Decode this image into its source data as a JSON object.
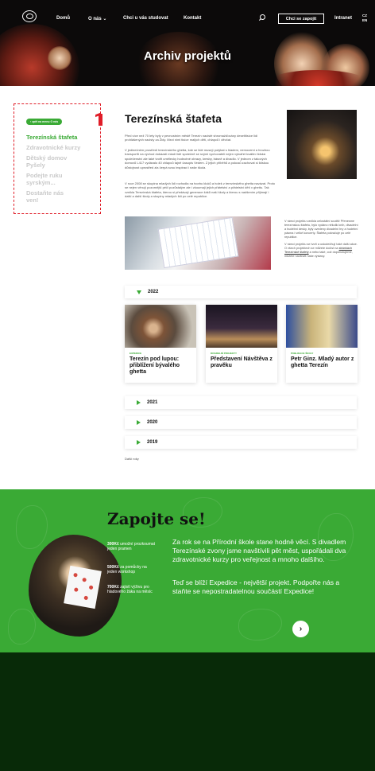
{
  "header": {
    "nav": [
      "Domů",
      "O nás",
      "Chci u vás studovat",
      "Kontakt"
    ],
    "nav_caret": "⌄",
    "join_label": "Chci se zapojit",
    "intranet_label": "Intranet",
    "lang": [
      "CZ",
      "EN"
    ],
    "hero_title": "Archiv projektů"
  },
  "sidebar": {
    "back_label": "‹  zpět na menu O nás",
    "items": [
      "Terezínská štafeta",
      "Zdravotnické kurzy",
      "Dětský domov Pyšely",
      "Podejte ruku syrským...",
      "Dostaňte nás ven!"
    ]
  },
  "article": {
    "title": "Terezínská štafeta",
    "p1": "Před více než 70 lety byly v pevnostním městě Terezín nacisté shromažďovány desetitisíce lidí prohlášených nacisty za Židy. Mezi nimi tisíce malých dětí, chlapců i děvčat.",
    "p2": "V jedinečném prostředí terezínského ghetta, kde se lidé musejí potýkat s hladem, nemocemi a hrozbou transportů na východ dokázali mladí lidé společně se svými vychovateli nejen vytvářet kvalitní lidská společenství ale také tvořit umělecky hodnotné obrazy, kresby, básně a divadlo. V jednom z takových domovů L417 vydávalo 40 chlapců tajně časopis Vedem. Z jejich příběhů a pokusů zachovat si lidskou důstojnost uprostřed zla čerpá svou inspiraci i naše škola.",
    "p3": "V roce 2008 se skupina mladých lidí rozhodla na tvorbu kluků a holek z terezínského ghetta navázat. Proto se nejen věnují pozornější péči pozůstalým ale i zkoumají jejich přátelství a přátelství dětí v ghettu. Tak vznikla Terezínská štafeta, kterou si předávají generace žáků naší školy a kterou s nadšením přijímají i další a další školy a skupiny mladých lidí po celé republice.",
    "side_p1": "V rámci projektu vznikla celostátní soutěž Přenesme terezínskou štafetu, bylo vydáno několik knih, divadelní a hudební desky, byly uvedeny divadelní hry a hudební pásma i velké koncerty. Štafeta pokračuje po celé republice.",
    "side_p2": "V rámci projektu se tvoří a uskutečňují také další akce. O všech projektech se můžete dočíst na ",
    "side_link": "stránkách Terezínské štafety",
    "side_p3": " a nebo také, což doporučujeme, můžete navštívit naše výstavy."
  },
  "years": [
    {
      "label": "2022",
      "open": true
    },
    {
      "label": "2021",
      "open": false
    },
    {
      "label": "2020",
      "open": false
    },
    {
      "label": "2019",
      "open": false
    }
  ],
  "cards": [
    {
      "category": "EXPEDICE",
      "title": "Terezín pod lupou: přiblížení bývalého ghetta"
    },
    {
      "category": "DIVADELNÍ PROJEKTY",
      "title": "Představení Návštěva z pravěku"
    },
    {
      "category": "PUBLIKACE ŠKOLY",
      "title": "Petr Ginz. Mladý autor z ghetta Terezín"
    }
  ],
  "older_label": "Další roky",
  "zapojte": {
    "title": "Zapojte se!",
    "stats": [
      {
        "amount": "300Kč",
        "text": " umožní prozkoumat jeden pramen"
      },
      {
        "amount": "500Kč",
        "text": " za pomůcky na jeden workshop"
      },
      {
        "amount": "700Kč",
        "text": " zajistí výživu pro hladového žáka na měsíc"
      }
    ],
    "text1": "Za rok se na Přírodní škole stane hodně věcí. S divadlem Terezínské zvony jsme navštívili pět měst, uspořádali dva zdravotnické kurzy pro veřejnost a mnoho dalšího.",
    "text2": "Teď se blíží Expedice - největší projekt. Podpořte nás a staňte se nepostradatelnou součástí Expedice!",
    "arrow": "›"
  },
  "colors": {
    "green": "#3aaa35",
    "red": "#e01d28",
    "footer": "#082a08"
  }
}
